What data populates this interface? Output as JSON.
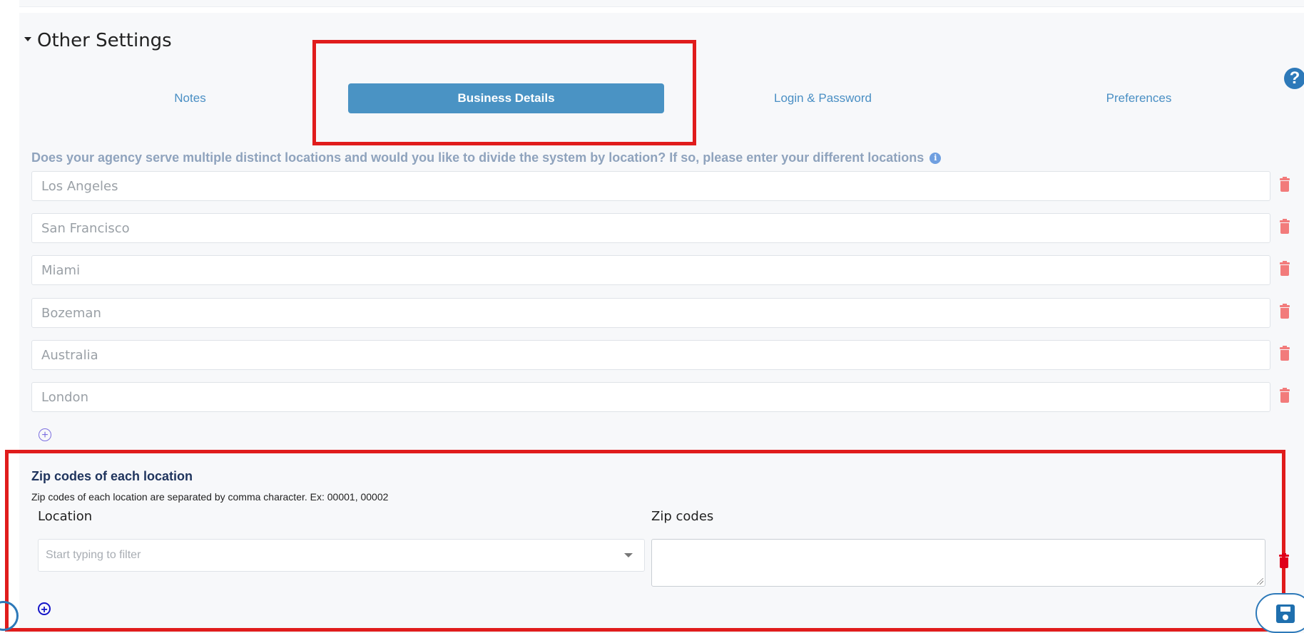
{
  "section": {
    "title": "Other Settings"
  },
  "tabs": [
    {
      "label": "Notes",
      "active": false
    },
    {
      "label": "Business Details",
      "active": true
    },
    {
      "label": "Login & Password",
      "active": false
    },
    {
      "label": "Preferences",
      "active": false
    }
  ],
  "help": {
    "label": "?"
  },
  "locations": {
    "question": "Does your agency serve multiple distinct locations and would you like to divide the system by location? If so, please enter your different locations",
    "info_label": "i",
    "items": [
      "Los Angeles",
      "San Francisco",
      "Miami",
      "Bozeman",
      "Australia",
      "London"
    ],
    "add_label": "+"
  },
  "zip": {
    "title": "Zip codes of each location",
    "description": "Zip codes of each location are separated by comma character. Ex: 00001, 00002",
    "location_label": "Location",
    "zip_label": "Zip codes",
    "select_placeholder": "Start typing to filter",
    "zip_value": "",
    "add_label": "+"
  },
  "colors": {
    "accent": "#4a93c4",
    "tab_text": "#4a8fc4",
    "highlight": "#e01c1c",
    "trash": "#f27b7b",
    "trash_active": "#e0001a",
    "heading_dark": "#20355e"
  }
}
